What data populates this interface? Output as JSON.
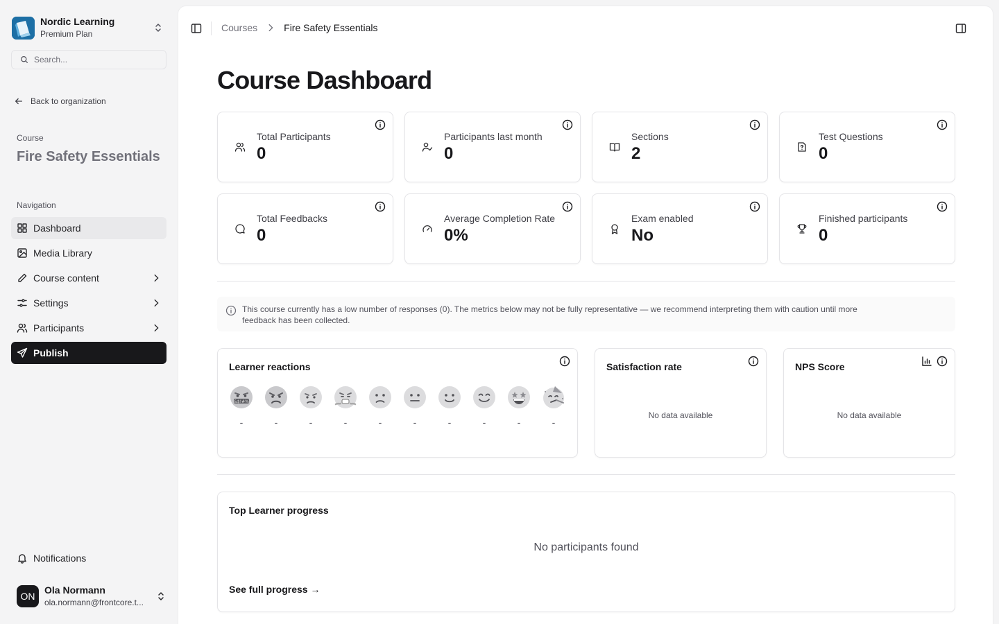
{
  "org": {
    "name": "Nordic Learning",
    "plan": "Premium Plan"
  },
  "search": {
    "placeholder": "Search..."
  },
  "back_link": "Back to organization",
  "course": {
    "label": "Course",
    "name": "Fire Safety Essentials"
  },
  "navigation": {
    "label": "Navigation",
    "items": [
      {
        "label": "Dashboard",
        "icon": "dashboard-icon",
        "chevron": false
      },
      {
        "label": "Media Library",
        "icon": "image-icon",
        "chevron": false
      },
      {
        "label": "Course content",
        "icon": "pencil-icon",
        "chevron": true
      },
      {
        "label": "Settings",
        "icon": "sliders-icon",
        "chevron": true
      },
      {
        "label": "Participants",
        "icon": "users-icon",
        "chevron": true
      },
      {
        "label": "Publish",
        "icon": "send-icon",
        "chevron": false
      }
    ]
  },
  "notifications": "Notifications",
  "user": {
    "initials": "ON",
    "name": "Ola Normann",
    "email": "ola.normann@frontcore.t..."
  },
  "breadcrumb": {
    "parent": "Courses",
    "current": "Fire Safety Essentials"
  },
  "page_title": "Course Dashboard",
  "stats": [
    {
      "label": "Total Participants",
      "value": "0",
      "icon": "users-icon"
    },
    {
      "label": "Participants last month",
      "value": "0",
      "icon": "user-check-icon"
    },
    {
      "label": "Sections",
      "value": "2",
      "icon": "book-icon"
    },
    {
      "label": "Test Questions",
      "value": "0",
      "icon": "question-file-icon"
    },
    {
      "label": "Total Feedbacks",
      "value": "0",
      "icon": "message-circle-icon"
    },
    {
      "label": "Average Completion Rate",
      "value": "0%",
      "icon": "gauge-icon"
    },
    {
      "label": "Exam enabled",
      "value": "No",
      "icon": "award-icon"
    },
    {
      "label": "Finished participants",
      "value": "0",
      "icon": "trophy-icon"
    }
  ],
  "notice": "This course currently has a low number of responses (0). The metrics below may not be fully representative — we recommend interpreting them with caution until more feedback has been collected.",
  "learner_reactions": {
    "title": "Learner reactions",
    "reactions": [
      {
        "emoji": "cursing-face",
        "count": "-"
      },
      {
        "emoji": "angry-face",
        "count": "-"
      },
      {
        "emoji": "pouting-face",
        "count": "-"
      },
      {
        "emoji": "steam-face",
        "count": "-"
      },
      {
        "emoji": "confused-face",
        "count": "-"
      },
      {
        "emoji": "neutral-face",
        "count": "-"
      },
      {
        "emoji": "slightly-smiling-face",
        "count": "-"
      },
      {
        "emoji": "smiling-face",
        "count": "-"
      },
      {
        "emoji": "star-struck-face",
        "count": "-"
      },
      {
        "emoji": "partying-face",
        "count": "-"
      }
    ]
  },
  "satisfaction": {
    "title": "Satisfaction rate",
    "empty": "No data available"
  },
  "nps": {
    "title": "NPS Score",
    "empty": "No data available"
  },
  "top_progress": {
    "title": "Top Learner progress",
    "empty": "No participants found",
    "link": "See full progress →"
  },
  "colors": {
    "accent_dark": "#18181b",
    "logo_blue": "#1d6fa5",
    "muted_text": "#71717a"
  }
}
